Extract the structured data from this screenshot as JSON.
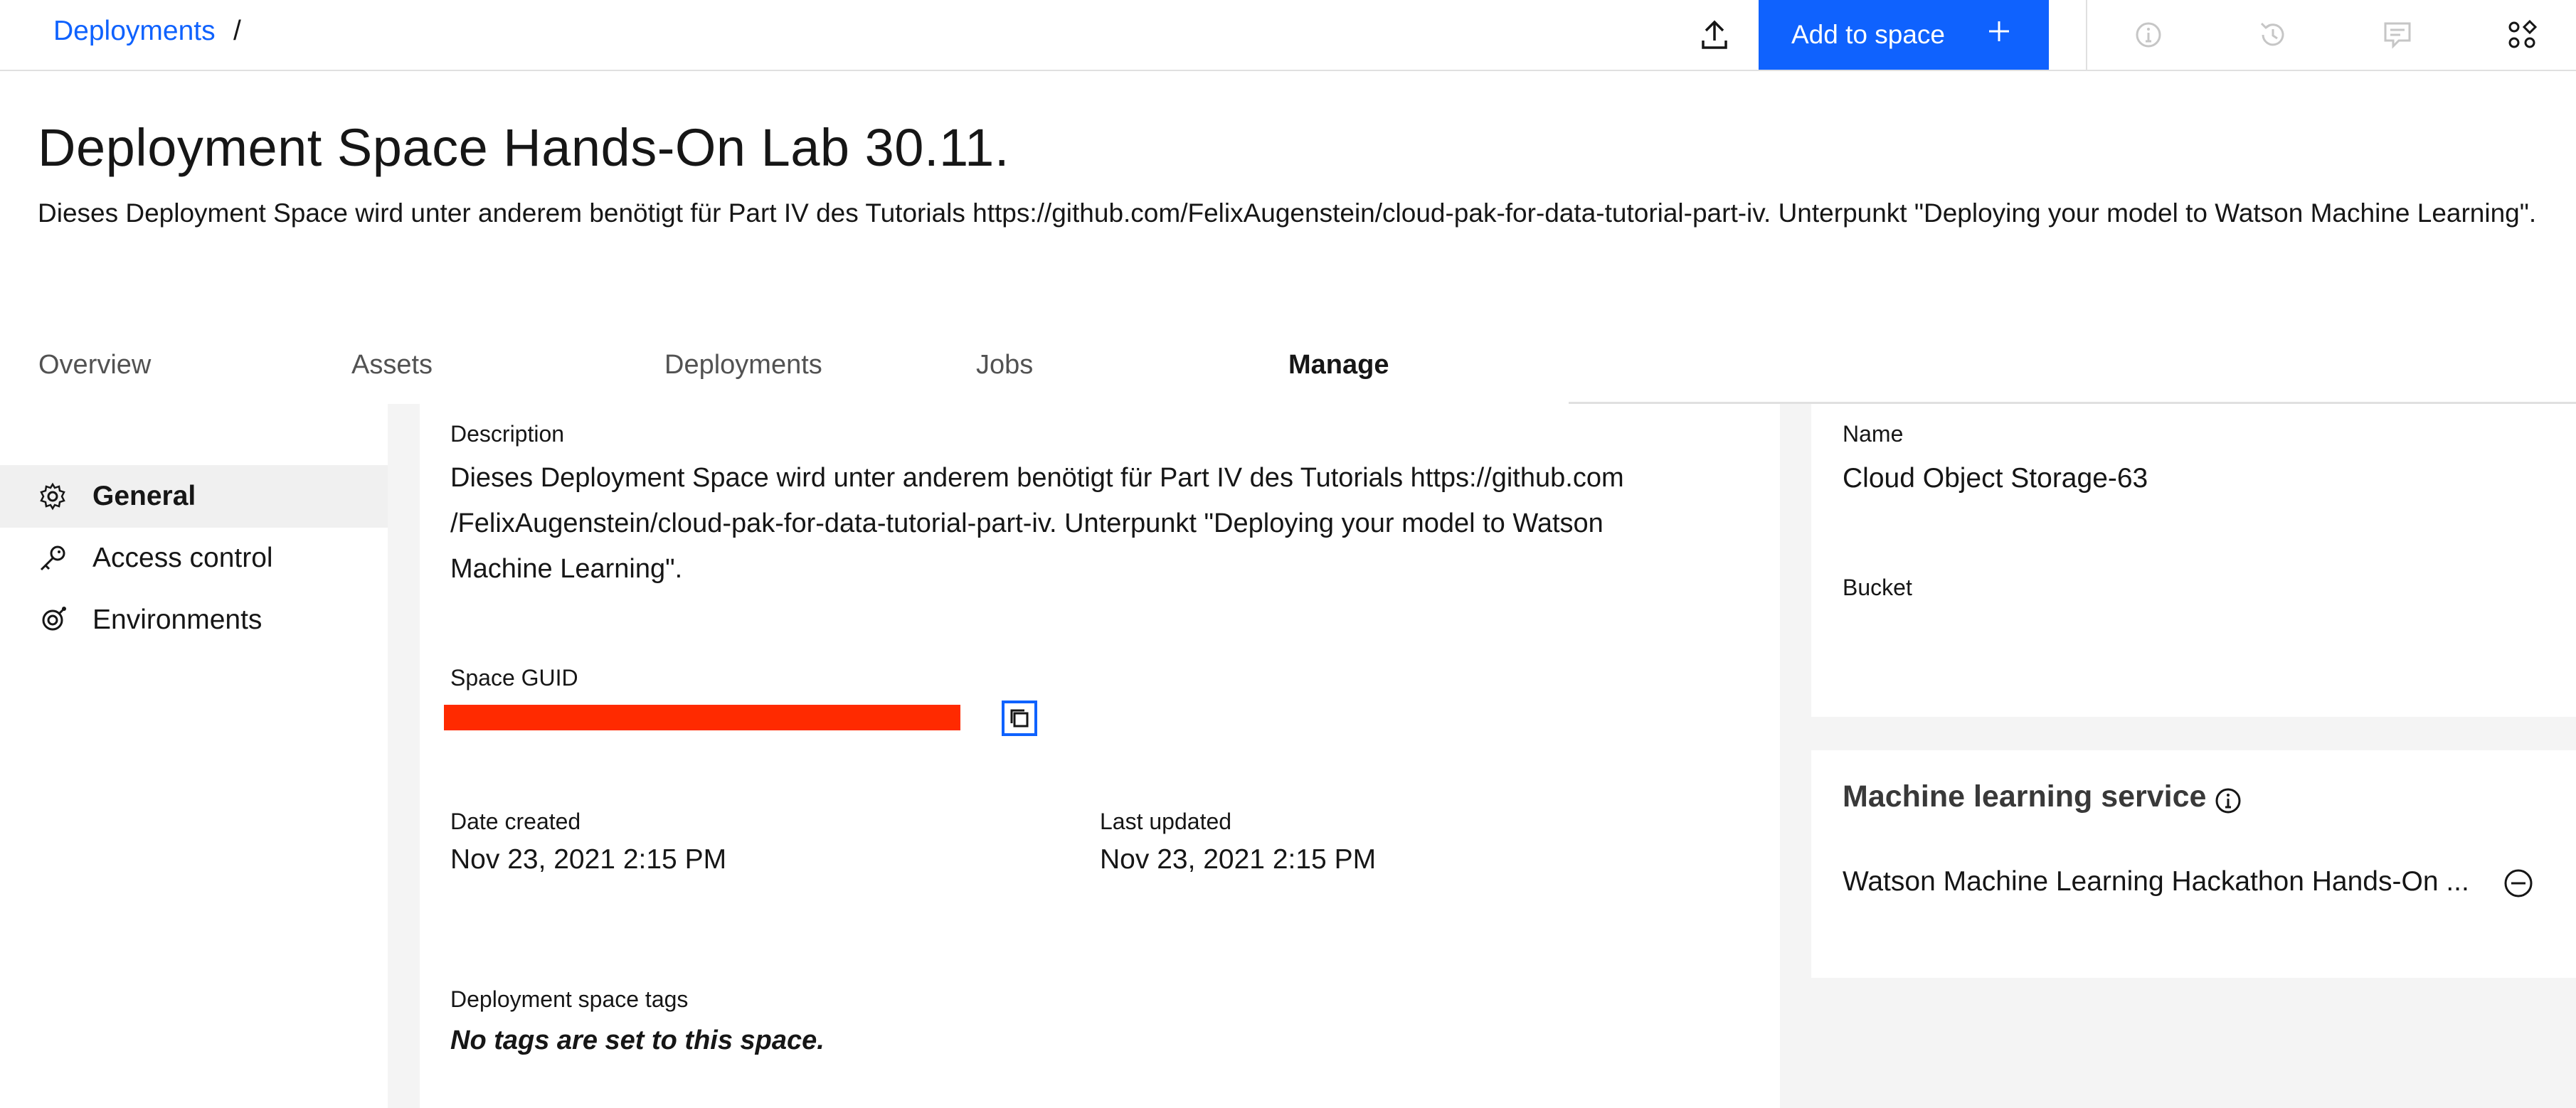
{
  "header": {
    "breadcrumb": "Deployments",
    "breadcrumb_separator": "/",
    "add_button_label": "Add to space",
    "icons": [
      "upload-icon",
      "add-icon",
      "info-icon",
      "history-icon",
      "comment-icon",
      "apps-icon"
    ]
  },
  "page": {
    "title": "Deployment Space Hands-On Lab 30.11.",
    "subtitle": "Dieses Deployment Space wird unter anderem benötigt für Part IV des Tutorials https://github.com/FelixAugenstein/cloud-pak-for-data-tutorial-part-iv. Unterpunkt \"Deploying your model to Watson Machine Learning\"."
  },
  "tabs": [
    {
      "label": "Overview"
    },
    {
      "label": "Assets"
    },
    {
      "label": "Deployments"
    },
    {
      "label": "Jobs"
    },
    {
      "label": "Manage"
    }
  ],
  "active_tab": "Manage",
  "sidebar": {
    "items": [
      {
        "label": "General",
        "icon": "settings-icon",
        "active": true
      },
      {
        "label": "Access control",
        "icon": "key-icon"
      },
      {
        "label": "Environments",
        "icon": "environment-icon"
      }
    ]
  },
  "general": {
    "description_label": "Description",
    "description": "Dieses Deployment Space wird unter anderem benötigt für Part IV des Tutorials https://github.com /FelixAugenstein/cloud-pak-for-data-tutorial-part-iv. Unterpunkt \"Deploying your model to Watson Machine Learning\".",
    "guid_label": "Space GUID",
    "date_created_label": "Date created",
    "date_created": "Nov 23, 2021 2:15 PM",
    "last_updated_label": "Last updated",
    "last_updated": "Nov 23, 2021 2:15 PM",
    "tags_label": "Deployment space tags",
    "tags_empty": "No tags are set to this space."
  },
  "storage": {
    "name_label": "Name",
    "name": "Cloud Object Storage-63",
    "bucket_label": "Bucket"
  },
  "ml_service": {
    "title": "Machine learning service",
    "instance": "Watson Machine Learning Hackathon Hands-On ..."
  },
  "colors": {
    "accent": "#0f62fe",
    "redaction": "#ff2a00",
    "panel_bg": "#f4f4f4"
  }
}
